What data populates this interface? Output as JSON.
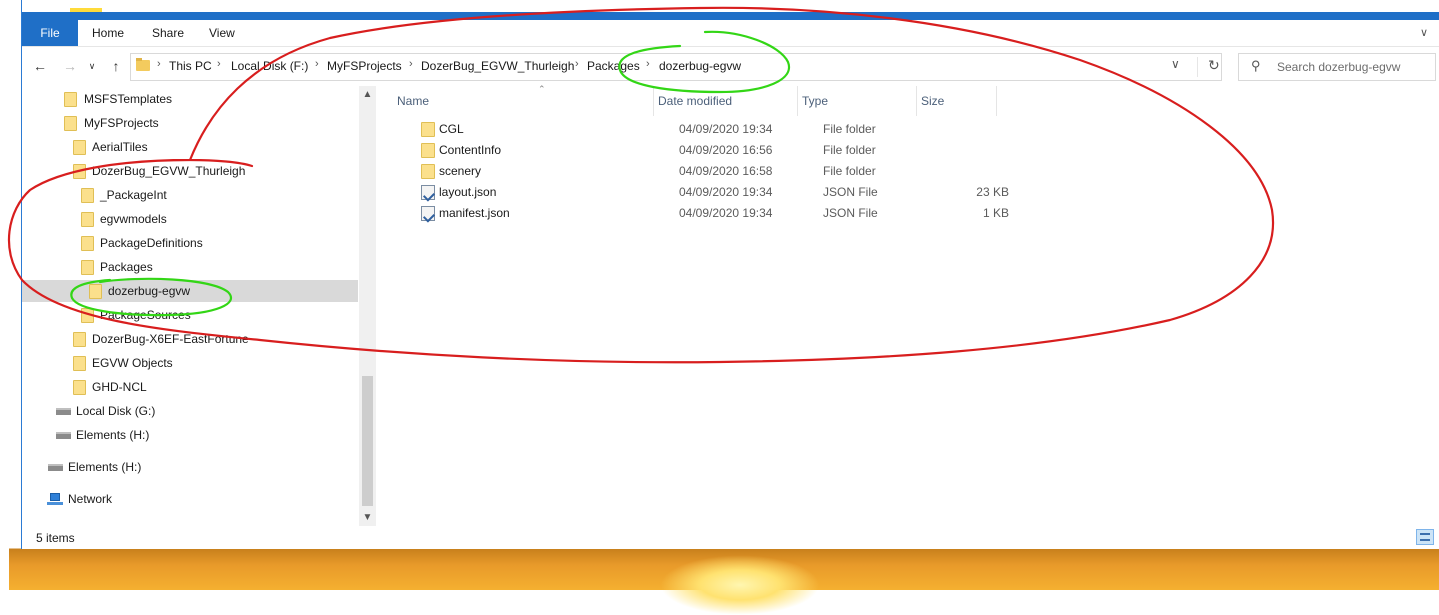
{
  "ribbon": {
    "file": "File",
    "home": "Home",
    "share": "Share",
    "view": "View"
  },
  "navbar": {
    "back_icon": "back-arrow-icon",
    "forward_icon": "forward-arrow-icon",
    "up_icon": "up-arrow-icon",
    "breadcrumb": [
      "This PC",
      "Local Disk (F:)",
      "MyFSProjects",
      "DozerBug_EGVW_Thurleigh",
      "Packages",
      "dozerbug-egvw"
    ],
    "search_placeholder": "Search dozerbug-egvw"
  },
  "nav_tree": [
    {
      "label": "MSFSTemplates",
      "icon": "folder-icon"
    },
    {
      "label": "MyFSProjects",
      "icon": "folder-icon"
    },
    {
      "label": "AerialTiles",
      "icon": "folder-icon"
    },
    {
      "label": "DozerBug_EGVW_Thurleigh",
      "icon": "folder-icon"
    },
    {
      "label": "_PackageInt",
      "icon": "folder-icon"
    },
    {
      "label": "egvwmodels",
      "icon": "folder-icon"
    },
    {
      "label": "PackageDefinitions",
      "icon": "folder-icon"
    },
    {
      "label": "Packages",
      "icon": "folder-icon"
    },
    {
      "label": "dozerbug-egvw",
      "icon": "folder-icon",
      "selected": true
    },
    {
      "label": "PackageSources",
      "icon": "folder-icon"
    },
    {
      "label": "DozerBug-X6EF-EastFortune",
      "icon": "folder-icon"
    },
    {
      "label": "EGVW Objects",
      "icon": "folder-icon"
    },
    {
      "label": "GHD-NCL",
      "icon": "folder-icon"
    },
    {
      "label": "Local Disk (G:)",
      "icon": "drive-icon"
    },
    {
      "label": "Elements (H:)",
      "icon": "drive-icon"
    },
    {
      "label": "Elements (H:)",
      "icon": "drive-icon"
    },
    {
      "label": "Network",
      "icon": "network-icon"
    }
  ],
  "columns": {
    "name": "Name",
    "date": "Date modified",
    "type": "Type",
    "size": "Size"
  },
  "files": [
    {
      "name": "CGL",
      "date": "04/09/2020 19:34",
      "type": "File folder",
      "size": "",
      "icon": "folder-icon"
    },
    {
      "name": "ContentInfo",
      "date": "04/09/2020 16:56",
      "type": "File folder",
      "size": "",
      "icon": "folder-icon"
    },
    {
      "name": "scenery",
      "date": "04/09/2020 16:58",
      "type": "File folder",
      "size": "",
      "icon": "folder-icon"
    },
    {
      "name": "layout.json",
      "date": "04/09/2020 19:34",
      "type": "JSON File",
      "size": "23 KB",
      "icon": "json-file-icon"
    },
    {
      "name": "manifest.json",
      "date": "04/09/2020 19:34",
      "type": "JSON File",
      "size": "1 KB",
      "icon": "json-file-icon"
    }
  ],
  "status": {
    "count": "5 items"
  },
  "colors": {
    "accent": "#1f6fc7",
    "annotation_red": "#d81e1e",
    "annotation_green": "#33d616",
    "selection": "#d9d9d9"
  }
}
